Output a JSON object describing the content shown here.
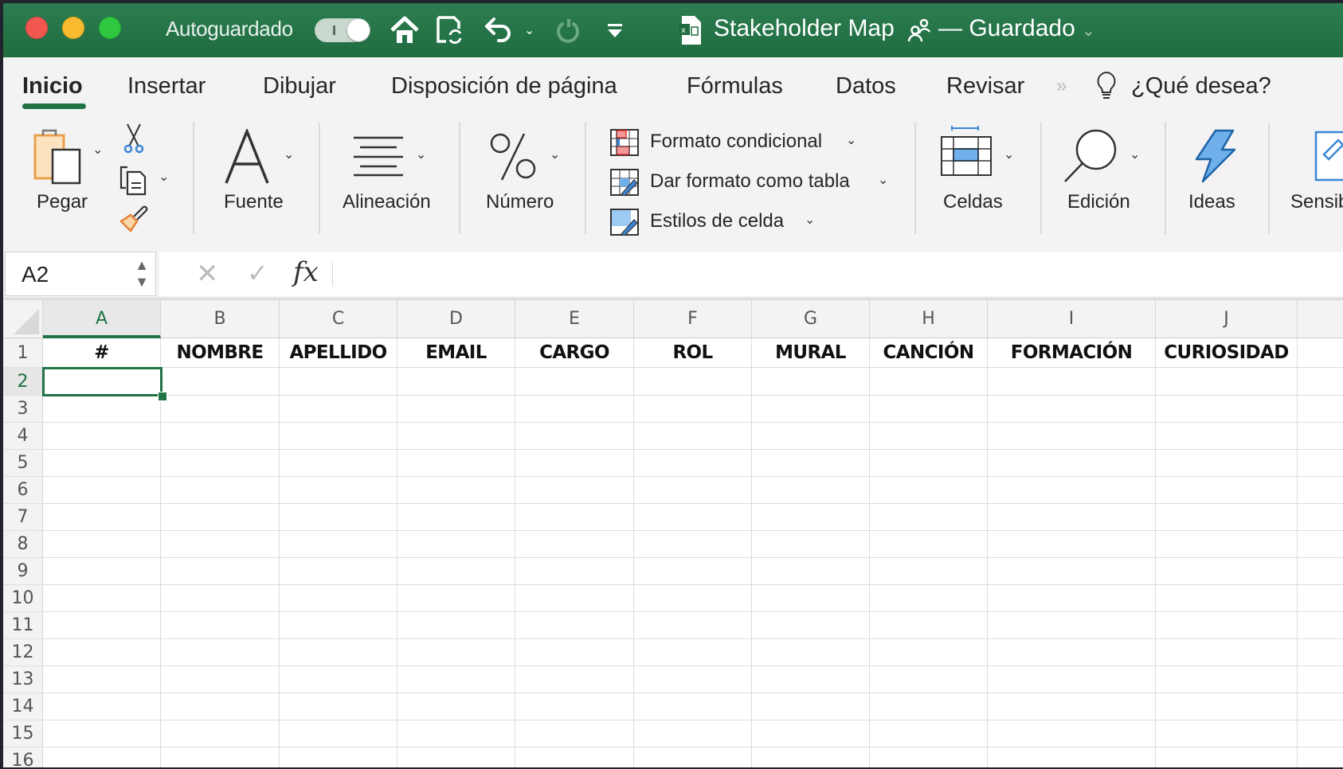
{
  "window": {
    "autosave_label": "Autoguardado",
    "autosave_state": "off",
    "document_title": "Stakeholder Map",
    "save_status": "— Guardado",
    "traffic_lights": [
      "close",
      "minimize",
      "zoom"
    ],
    "quick_access_icons": [
      "home-icon",
      "sync-save-icon",
      "undo-icon",
      "redo-icon",
      "customize-toolbar-icon"
    ]
  },
  "tabs": [
    {
      "label": "Inicio",
      "active": true
    },
    {
      "label": "Insertar"
    },
    {
      "label": "Dibujar"
    },
    {
      "label": "Disposición de página"
    },
    {
      "label": "Fórmulas"
    },
    {
      "label": "Datos"
    },
    {
      "label": "Revisar"
    }
  ],
  "tell_me": "¿Qué desea?",
  "ribbon": {
    "paste": "Pegar",
    "font": "Fuente",
    "alignment": "Alineación",
    "number": "Número",
    "conditional_format": "Formato condicional",
    "format_as_table": "Dar formato como tabla",
    "cell_styles": "Estilos de celda",
    "cells": "Celdas",
    "editing": "Edición",
    "ideas": "Ideas",
    "sensitivity": "Sensib"
  },
  "formula_bar": {
    "name_box": "A2",
    "formula": ""
  },
  "sheet": {
    "columns": [
      "A",
      "B",
      "C",
      "D",
      "E",
      "F",
      "G",
      "H",
      "I",
      "J",
      ""
    ],
    "selected_column": "A",
    "selected_row": 2,
    "rows": [
      "1",
      "2",
      "3",
      "4",
      "5",
      "6",
      "7",
      "8",
      "9",
      "10",
      "11",
      "12",
      "13",
      "14",
      "15",
      "16"
    ],
    "header_row": [
      "#",
      "NOMBRE",
      "APELLIDO",
      "EMAIL",
      "CARGO",
      "ROL",
      "MURAL",
      "CANCIÓN",
      "FORMACIÓN",
      "CURIOSIDAD",
      ""
    ]
  },
  "colors": {
    "accent": "#217346",
    "titlebar": "#2c7d51"
  }
}
